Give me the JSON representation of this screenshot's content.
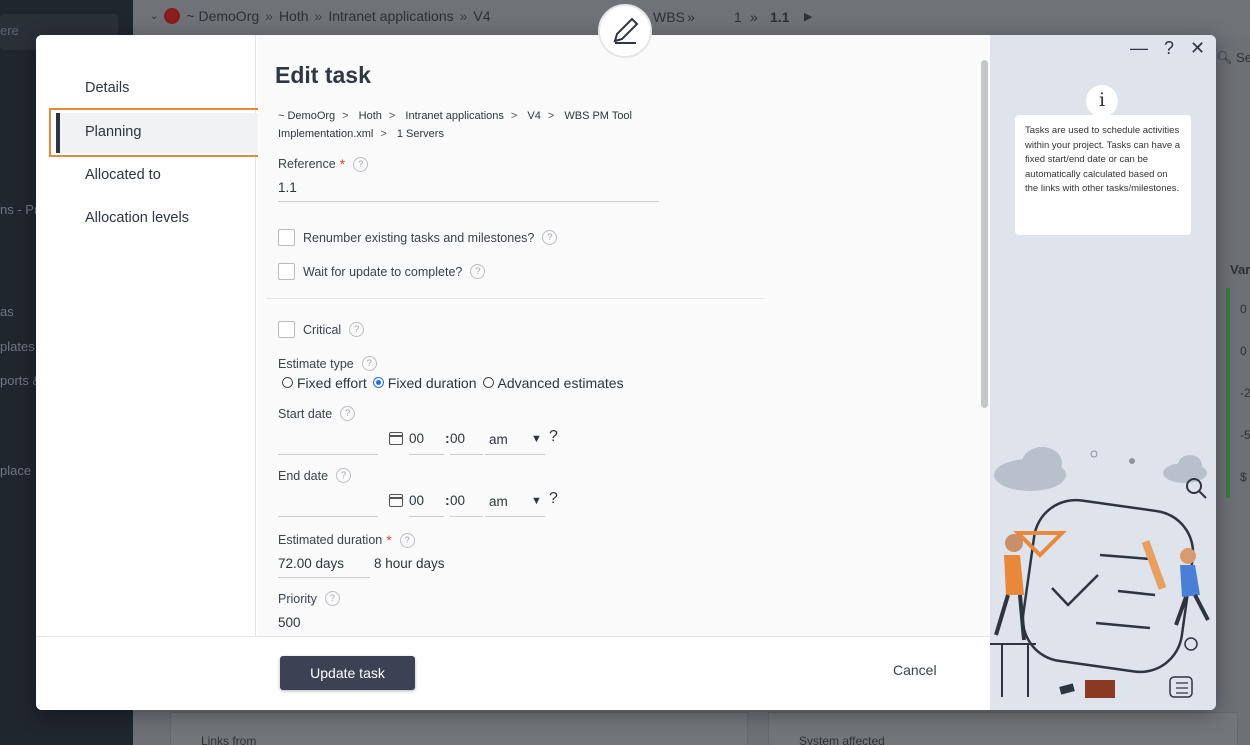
{
  "background": {
    "search_placeholder": "ere",
    "sidebar_items": [
      "ns - Pro",
      "as",
      "plates",
      "ports &",
      "place"
    ],
    "breadcrumb": [
      "~ DemoOrg",
      "Hoth",
      "Intranet applications",
      "V4",
      "WBS",
      "1",
      "1.1"
    ],
    "search_label": "Sea",
    "column_header": "Var",
    "column_values": [
      "0",
      "0",
      "-2",
      "-5",
      "$"
    ],
    "panel_left_label": "Links from",
    "panel_right_label": "System affected"
  },
  "modal": {
    "nav": {
      "items": [
        "Details",
        "Planning",
        "Allocated to",
        "Allocation levels"
      ],
      "active_index": 1
    },
    "title": "Edit task",
    "path": [
      "~ DemoOrg",
      "Hoth",
      "Intranet applications",
      "V4",
      "WBS PM Tool Implementation.xml",
      "1 Servers"
    ],
    "reference": {
      "label": "Reference",
      "value": "1.1"
    },
    "renumber_label": "Renumber existing tasks and milestones?",
    "wait_label": "Wait for update to complete?",
    "critical_label": "Critical",
    "estimate_type": {
      "label": "Estimate type",
      "options": [
        "Fixed effort",
        "Fixed duration",
        "Advanced estimates"
      ],
      "selected": "Fixed duration"
    },
    "start_date": {
      "label": "Start date",
      "hour": "00",
      "minute": "00",
      "ampm": "am"
    },
    "end_date": {
      "label": "End date",
      "hour": "00",
      "minute": "00",
      "ampm": "am"
    },
    "estimated_duration": {
      "label": "Estimated duration",
      "value": "72.00 days",
      "unit": "8 hour days"
    },
    "priority": {
      "label": "Priority",
      "value": "500"
    },
    "buttons": {
      "update": "Update task",
      "cancel": "Cancel"
    },
    "window_controls": {
      "minimize": "—",
      "help": "?",
      "close": "✕"
    },
    "help_badge": "i",
    "help_text": "Tasks are used to schedule activities within your project. Tasks can have a fixed start/end date or can be automatically calculated based on the links with other tasks/milestones.",
    "colors": {
      "accent": "#e8883a",
      "primary_button": "#3a4253",
      "radio_selected": "#1e6fd9"
    }
  }
}
